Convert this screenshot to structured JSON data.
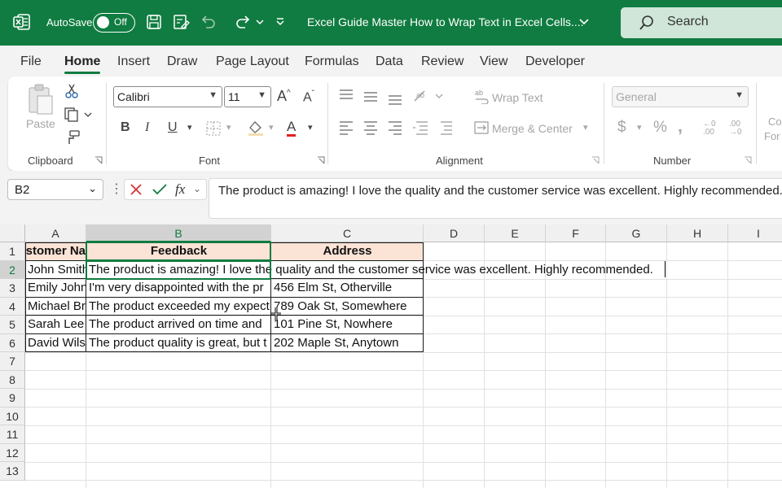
{
  "titlebar": {
    "autosave_label": "AutoSave",
    "toggle_state": "Off",
    "doc_title": "Excel Guide Master How to Wrap Text in Excel Cells....",
    "search_label": "Search",
    "bg_color": "#107c41"
  },
  "menu": {
    "tabs": [
      "File",
      "Home",
      "Insert",
      "Draw",
      "Page Layout",
      "Formulas",
      "Data",
      "Review",
      "View",
      "Developer"
    ],
    "active": "Home"
  },
  "ribbon": {
    "clipboard": {
      "paste_label": "Paste",
      "group_label": "Clipboard"
    },
    "font": {
      "font_name": "Calibri",
      "font_size": "11",
      "group_label": "Font"
    },
    "alignment": {
      "wrap_text_label": "Wrap Text",
      "merge_label": "Merge & Center",
      "group_label": "Alignment"
    },
    "number": {
      "format": "General",
      "group_label": "Number"
    },
    "styles_partial": {
      "line1": "Co",
      "line2": "For"
    }
  },
  "formula_bar": {
    "name_box": "B2",
    "fx_label": "fx",
    "content": "The product is amazing! I love the quality and the customer service was excellent. Highly recommended."
  },
  "grid": {
    "columns": [
      "A",
      "B",
      "C",
      "D",
      "E",
      "F",
      "G",
      "H",
      "I"
    ],
    "rows": [
      "1",
      "2",
      "3",
      "4",
      "5",
      "6",
      "7",
      "8",
      "9",
      "10",
      "11",
      "12",
      "13"
    ],
    "selected_column": "B",
    "selected_row": "2",
    "headers": {
      "a1": "stomer Na",
      "b1": "Feedback",
      "c1": "Address"
    },
    "data_rows": [
      {
        "a": "John Smith",
        "b": "The product is amazing! I love the quality and the customer service was excellent. Highly recommended.",
        "c": ""
      },
      {
        "a": "Emily John",
        "b": "I'm very disappointed with the pr",
        "c": "456 Elm St, Otherville"
      },
      {
        "a": "Michael Br",
        "b": "The product exceeded my expect",
        "c": "789 Oak St, Somewhere"
      },
      {
        "a": "Sarah Lee",
        "b": "The product arrived on time and",
        "c": "101 Pine St, Nowhere"
      },
      {
        "a": "David Wils",
        "b": "The product quality is great, but t",
        "c": "202 Maple St, Anytown"
      }
    ],
    "header_fill": "#fbe3d6",
    "accent": "#107c41"
  }
}
